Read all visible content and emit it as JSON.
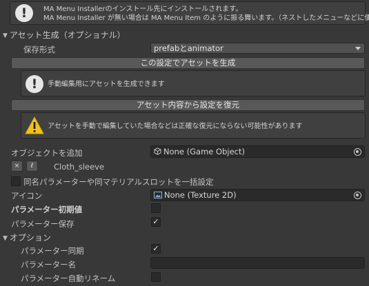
{
  "info_top": {
    "line1": "MA Menu Installerのインストール先にインストールされます。",
    "line2": "MA Menu Installer が無い場合は MA Menu Item のように振る舞います。（ネストしたメニューなどに便利）"
  },
  "asset_section": {
    "title": "アセット生成（オプショナル）",
    "save_format_label": "保存形式",
    "save_format_value": "prefabとanimator",
    "generate_button": "この設定でアセットを生成",
    "generate_info": "手動編集用にアセットを生成できます",
    "restore_button": "アセット内容から設定を復元",
    "restore_warning": "アセットを手動で編集していた場合などは正確な復元にならない可能性があります"
  },
  "object_add": {
    "label": "オブジェクトを追加",
    "field_value": "None (Game Object)",
    "remove_symbol": "×",
    "edit_symbol": "ℓ",
    "item_name": "Cloth_sleeve"
  },
  "bulk_setting": {
    "label": "同名パラメーターや同マテリアルスロットを一括設定",
    "checked": false
  },
  "icon_field": {
    "label": "アイコン",
    "value": "None (Texture 2D)"
  },
  "param_default": {
    "label": "パラメーター初期値",
    "checked": false
  },
  "param_save": {
    "label": "パラメーター保存",
    "checked": true,
    "mark": "✓"
  },
  "options_section": {
    "title": "オプション",
    "param_sync_label": "パラメーター同期",
    "param_sync_checked": true,
    "param_sync_mark": "✓",
    "param_name_label": "パラメーター名",
    "param_name_value": "",
    "param_rename_label": "パラメーター自動リネーム",
    "param_rename_checked": false
  },
  "icons": {
    "info": "info-icon",
    "warning": "warning-icon",
    "picker": "object-picker-icon",
    "gameobject": "gameobject-cube-icon",
    "texture": "texture-icon",
    "foldout": "foldout-arrow-icon"
  },
  "colors": {
    "background": "#383838",
    "helpbox": "#404040",
    "button": "#585858",
    "field": "#2a2a2a",
    "warning_yellow": "#f2c21a"
  }
}
